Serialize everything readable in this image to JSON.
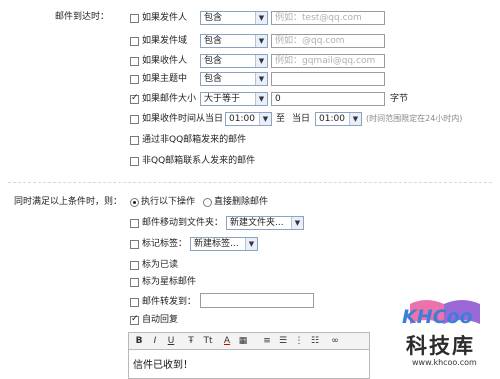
{
  "section1": {
    "label": "邮件到达时：",
    "rows": [
      {
        "label": "如果发件人",
        "checked": false,
        "select": "包含",
        "placeholder": "例如：test@qq.com"
      },
      {
        "label": "如果发件域",
        "checked": false,
        "select": "包含",
        "placeholder": "例如：@qq.com"
      },
      {
        "label": "如果收件人",
        "checked": false,
        "select": "包含",
        "placeholder": "例如：gqmail@qq.com"
      },
      {
        "label": "如果主题中",
        "checked": false,
        "select": "包含",
        "placeholder": ""
      },
      {
        "label": "如果邮件大小",
        "checked": true,
        "select": "大于等于",
        "value": "0",
        "unit": "字节"
      }
    ],
    "time_row": {
      "label": "如果收件时间从当日",
      "from": "01:00",
      "to_label": "至",
      "day_label": "当日",
      "to": "01:00",
      "hint": "(时间范围限定在24小时内)"
    },
    "extra": [
      {
        "label": "通过非QQ邮箱发来的邮件",
        "checked": false
      },
      {
        "label": "非QQ邮箱联系人发来的邮件",
        "checked": false
      }
    ]
  },
  "section2": {
    "label": "同时满足以上条件时，则：",
    "radios": [
      {
        "label": "执行以下操作",
        "selected": true
      },
      {
        "label": "直接删除邮件",
        "selected": false
      }
    ],
    "actions": {
      "move_label": "邮件移动到文件夹：",
      "move_select": "新建文件夹...",
      "tag_label": "标记标签：",
      "tag_select": "新建标签...",
      "mark_read": "标为已读",
      "mark_star": "标为星标邮件",
      "forward_label": "邮件转发到：",
      "forward_value": "",
      "auto_reply": "自动回复"
    },
    "auto_reply_checked": true
  },
  "editor": {
    "toolbar": [
      "B",
      "I",
      "U",
      "Ŧ",
      "Tt",
      "A",
      "▦",
      "≡",
      "☰",
      "⋮",
      "☷",
      "∞"
    ],
    "content": "信件已收到！"
  },
  "watermark": {
    "logo_text": "KHCoo",
    "cn_text": "科技库",
    "url": "www.khcoo.com"
  }
}
